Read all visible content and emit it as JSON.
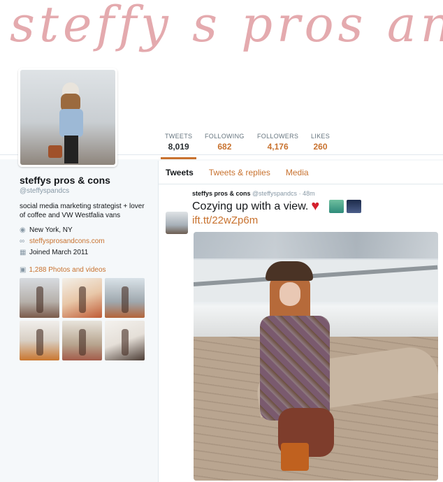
{
  "banner": {
    "text": "steffy s pros and"
  },
  "stats": {
    "tweets": {
      "label": "TWEETS",
      "value": "8,019"
    },
    "following": {
      "label": "FOLLOWING",
      "value": "682"
    },
    "followers": {
      "label": "FOLLOWERS",
      "value": "4,176"
    },
    "likes": {
      "label": "LIKES",
      "value": "260"
    }
  },
  "profile": {
    "name": "steffys pros & cons",
    "handle": "@steffyspandcs",
    "bio": "social media marketing strategist + lover of coffee and VW Westfalia vans",
    "location": "New York, NY",
    "website": "steffysprosandcons.com",
    "joined": "Joined March 2011",
    "photos_link": "1,288 Photos and videos"
  },
  "tabs": [
    "Tweets",
    "Tweets & replies",
    "Media"
  ],
  "tweet": {
    "name": "steffys pros & cons",
    "handle": "@steffyspandcs",
    "time": "· 48m",
    "text": "Cozying up with a view.",
    "link": "ift.tt/22wZp6m"
  },
  "icons": {
    "location": "location-pin-icon",
    "link": "link-icon",
    "calendar": "calendar-icon",
    "camera": "camera-icon"
  },
  "colors": {
    "accent": "#c8722f",
    "banner_text": "#e3a6aa"
  }
}
